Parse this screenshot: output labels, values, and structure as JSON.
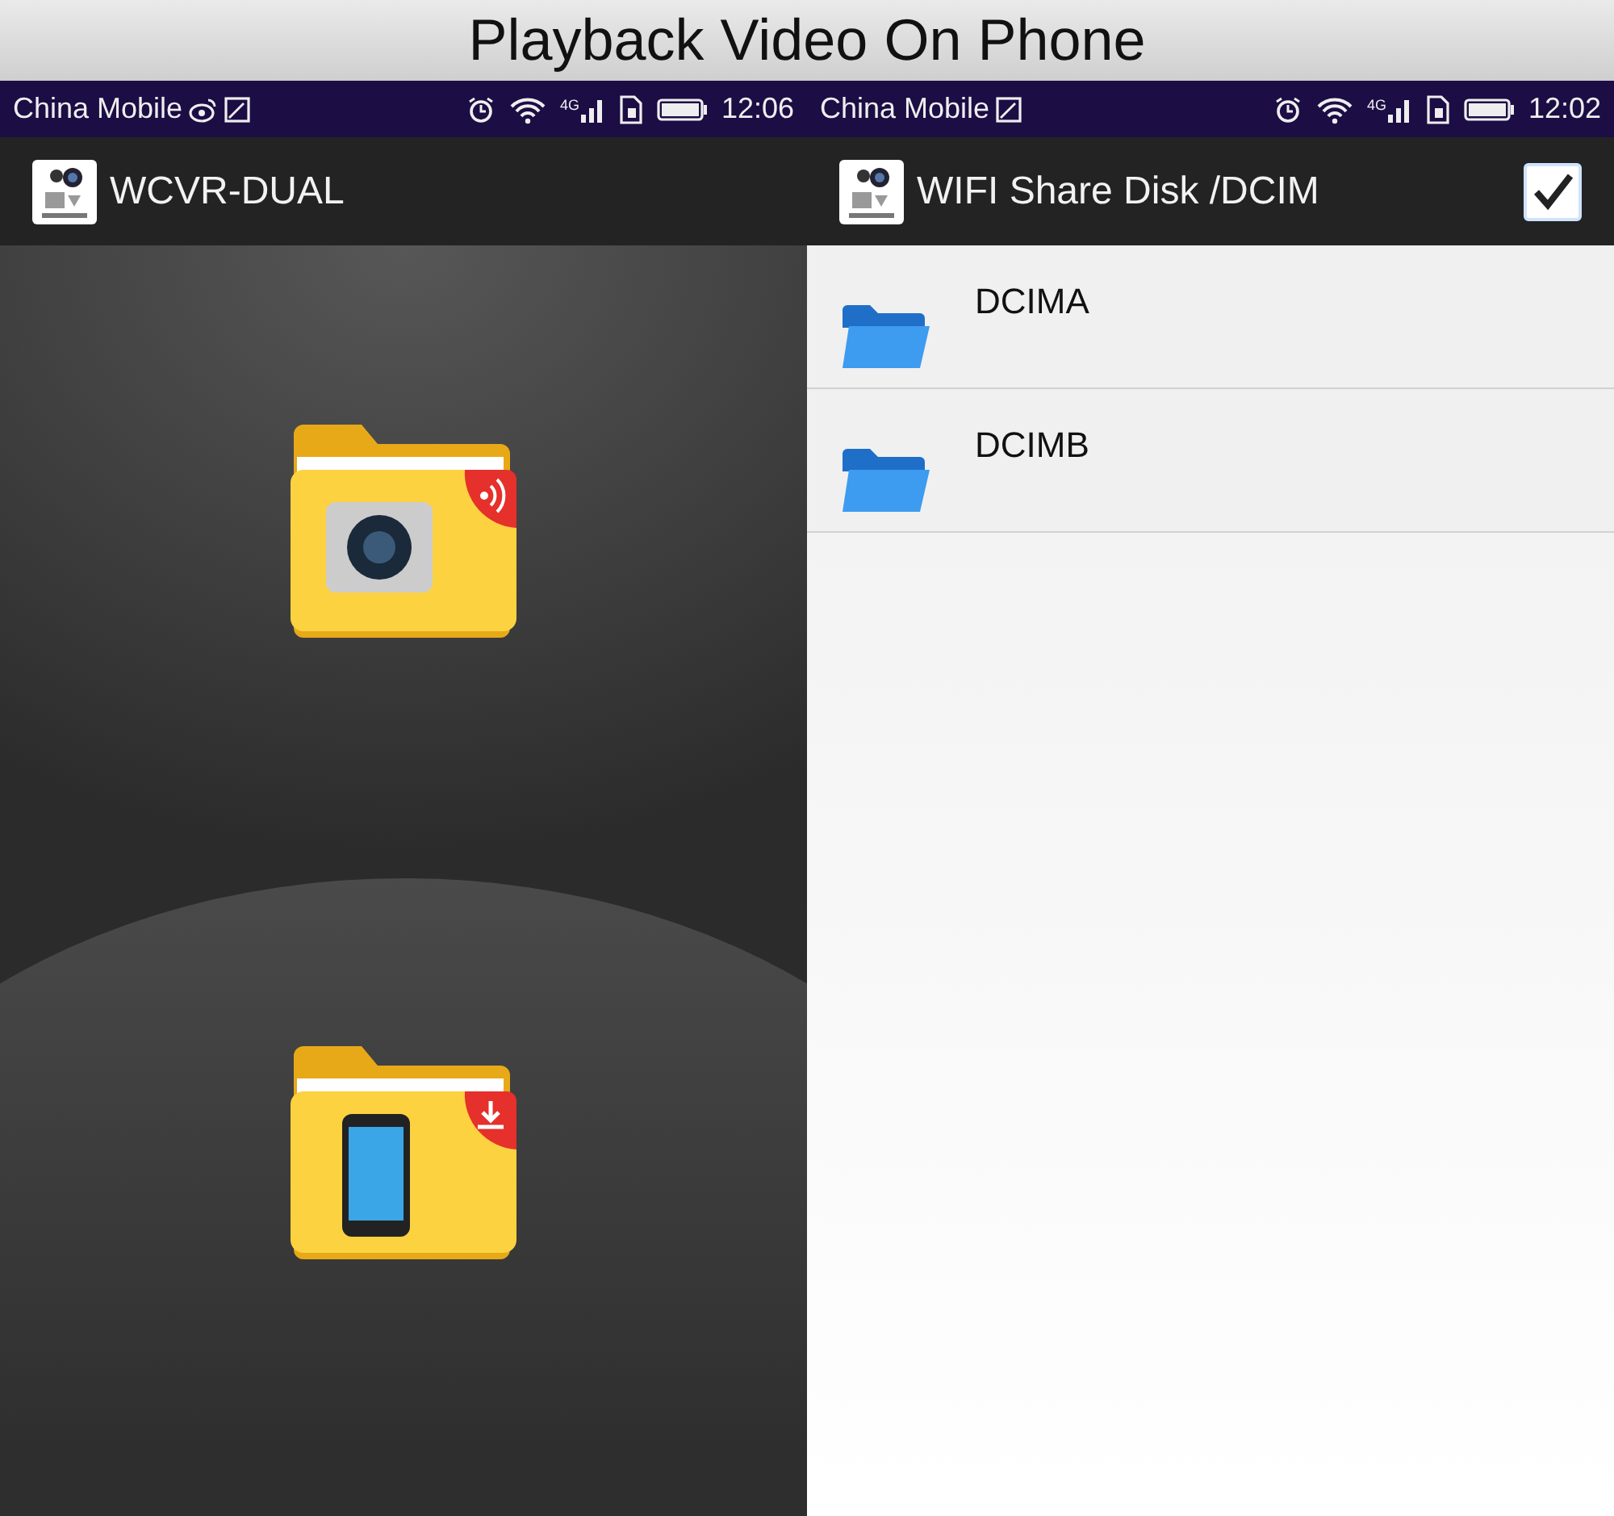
{
  "title": "Playback Video On Phone",
  "phones": [
    {
      "kind": "home",
      "status_bar": {
        "carrier": "China Mobile",
        "weibo_notification": true,
        "network_type": "4G",
        "time": "12:06"
      },
      "app_bar": {
        "title": "WCVR-DUAL"
      }
    },
    {
      "kind": "file_list",
      "status_bar": {
        "carrier": "China Mobile",
        "weibo_notification": false,
        "network_type": "4G",
        "time": "12:02"
      },
      "app_bar": {
        "title": "WIFI Share Disk /DCIM",
        "select_all_checked": true
      },
      "items": [
        {
          "name": "DCIMA"
        },
        {
          "name": "DCIMB"
        }
      ]
    }
  ]
}
